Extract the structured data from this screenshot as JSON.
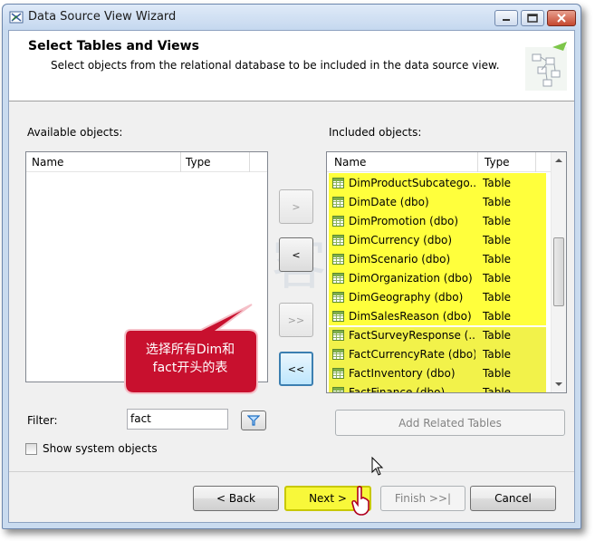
{
  "window": {
    "title": "Data Source View Wizard"
  },
  "header": {
    "title": "Select Tables and Views",
    "subtitle": "Select objects from the relational database to be included in the data source view."
  },
  "available": {
    "label": "Available objects:",
    "col_name": "Name",
    "col_type": "Type",
    "items": []
  },
  "included": {
    "label": "Included objects:",
    "col_name": "Name",
    "col_type": "Type",
    "items": [
      {
        "name": "DimProductSubcatego...",
        "type": "Table"
      },
      {
        "name": "DimDate (dbo)",
        "type": "Table"
      },
      {
        "name": "DimPromotion (dbo)",
        "type": "Table"
      },
      {
        "name": "DimCurrency (dbo)",
        "type": "Table"
      },
      {
        "name": "DimScenario (dbo)",
        "type": "Table"
      },
      {
        "name": "DimOrganization (dbo)",
        "type": "Table"
      },
      {
        "name": "DimGeography (dbo)",
        "type": "Table"
      },
      {
        "name": "DimSalesReason (dbo)",
        "type": "Table"
      },
      {
        "name": "FactSurveyResponse (...",
        "type": "Table"
      },
      {
        "name": "FactCurrencyRate (dbo)",
        "type": "Table"
      },
      {
        "name": "FactInventory (dbo)",
        "type": "Table"
      },
      {
        "name": "FactFinance (dbo)",
        "type": "Table"
      }
    ]
  },
  "move_buttons": {
    "add_one": ">",
    "remove_one": "<",
    "add_all": ">>",
    "remove_all": "<<"
  },
  "callout": {
    "line1": "选择所有Dim和",
    "line2": "fact开头的表",
    "color": "#c8102e"
  },
  "filter": {
    "label": "Filter:",
    "value": "fact"
  },
  "add_related_label": "Add Related Tables",
  "show_system_label": "Show system objects",
  "footer": {
    "back": "< Back",
    "next": "Next >",
    "finish": "Finish >>|",
    "cancel": "Cancel"
  },
  "watermark": "逸 客 在 线",
  "colors": {
    "highlight": "#ffff3c",
    "accent": "#3c7fb1"
  }
}
